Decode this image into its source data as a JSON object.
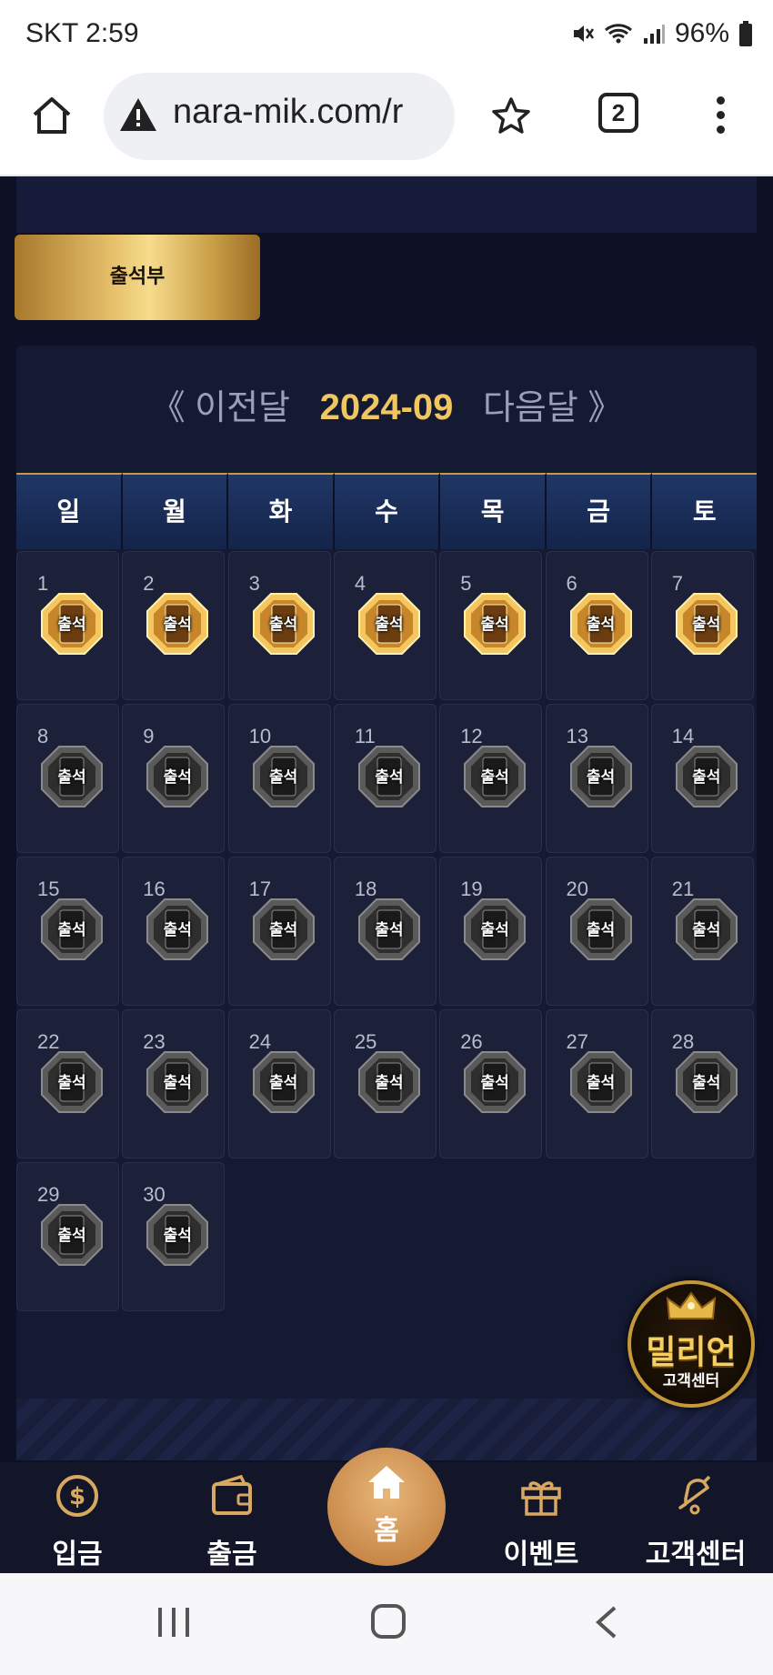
{
  "status_bar": {
    "time": "SKT 2:59",
    "battery": "96%"
  },
  "browser": {
    "url": "nara-mik.com/r",
    "tab_count": "2"
  },
  "page": {
    "tab_label": "출석부",
    "calendar": {
      "prev_label": "《 이전달",
      "month": "2024-09",
      "next_label": "다음달 》",
      "weekdays": [
        "일",
        "월",
        "화",
        "수",
        "목",
        "금",
        "토"
      ],
      "stamp_label": "출석",
      "days": [
        {
          "num": "1",
          "attended": true
        },
        {
          "num": "2",
          "attended": true
        },
        {
          "num": "3",
          "attended": true
        },
        {
          "num": "4",
          "attended": true
        },
        {
          "num": "5",
          "attended": true
        },
        {
          "num": "6",
          "attended": true
        },
        {
          "num": "7",
          "attended": true
        },
        {
          "num": "8",
          "attended": false
        },
        {
          "num": "9",
          "attended": false
        },
        {
          "num": "10",
          "attended": false
        },
        {
          "num": "11",
          "attended": false
        },
        {
          "num": "12",
          "attended": false
        },
        {
          "num": "13",
          "attended": false
        },
        {
          "num": "14",
          "attended": false
        },
        {
          "num": "15",
          "attended": false
        },
        {
          "num": "16",
          "attended": false
        },
        {
          "num": "17",
          "attended": false
        },
        {
          "num": "18",
          "attended": false
        },
        {
          "num": "19",
          "attended": false
        },
        {
          "num": "20",
          "attended": false
        },
        {
          "num": "21",
          "attended": false
        },
        {
          "num": "22",
          "attended": false
        },
        {
          "num": "23",
          "attended": false
        },
        {
          "num": "24",
          "attended": false
        },
        {
          "num": "25",
          "attended": false
        },
        {
          "num": "26",
          "attended": false
        },
        {
          "num": "27",
          "attended": false
        },
        {
          "num": "28",
          "attended": false
        },
        {
          "num": "29",
          "attended": false
        },
        {
          "num": "30",
          "attended": false
        }
      ]
    }
  },
  "cs_badge": {
    "title": "밀리언",
    "subtitle": "고객센터"
  },
  "bottom_nav": {
    "deposit": "입금",
    "withdraw": "출금",
    "home": "홈",
    "event": "이벤트",
    "support": "고객센터"
  },
  "colors": {
    "accent_gold": "#f0c660",
    "background": "#0e1126",
    "cell": "#1c2038"
  }
}
